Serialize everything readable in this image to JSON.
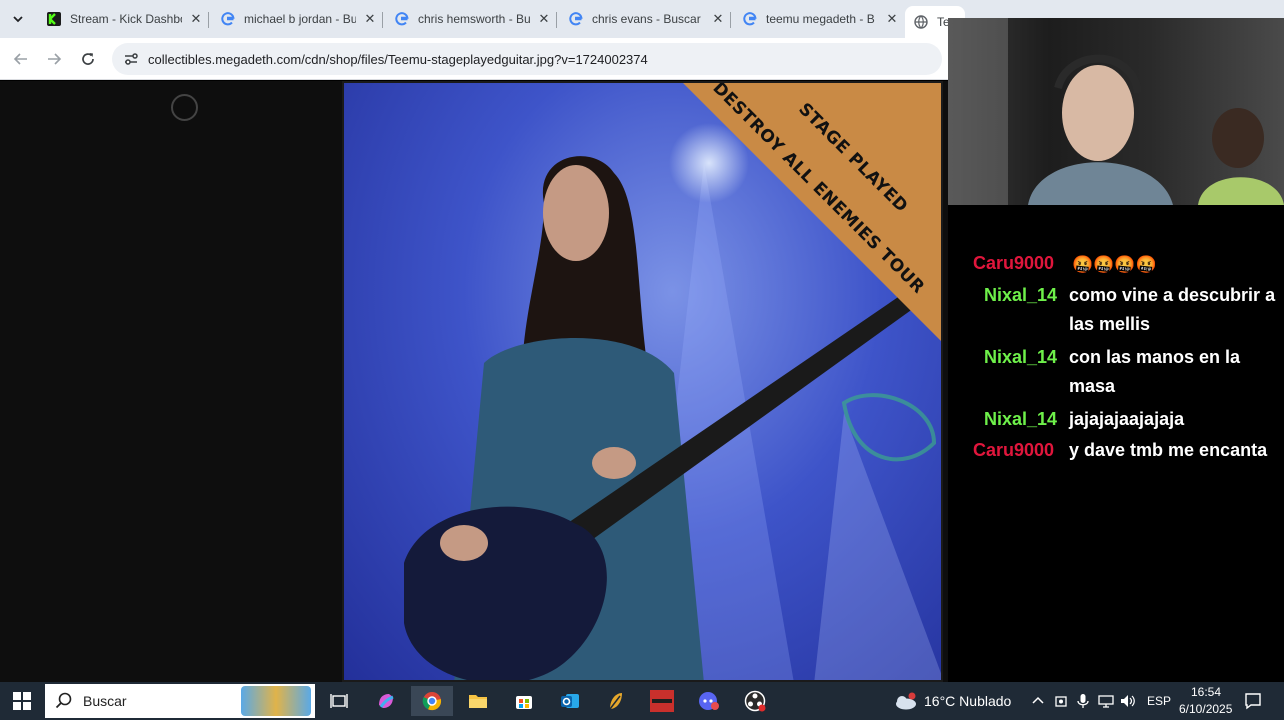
{
  "browser": {
    "tabs": [
      {
        "title": "Stream - Kick Dashbo",
        "icon": "kick-icon"
      },
      {
        "title": "michael b jordan - Bu",
        "icon": "google-icon"
      },
      {
        "title": "chris hemsworth - Bu",
        "icon": "google-icon"
      },
      {
        "title": "chris evans - Buscar c",
        "icon": "google-icon"
      },
      {
        "title": "teemu megadeth - B",
        "icon": "google-icon"
      },
      {
        "title": "Te",
        "icon": "globe-icon",
        "active": true
      }
    ],
    "url": "collectibles.megadeth.com/cdn/shop/files/Teemu-stageplayedguitar.jpg?v=1724002374"
  },
  "image": {
    "banner_line1": "STAGE PLAYED",
    "banner_line2": "DESTROY ALL ENEMIES TOUR",
    "banner_color": "#c98a45"
  },
  "chat": {
    "messages": [
      {
        "user": "Caru9000",
        "user_color": "#e0163c",
        "text": "🤬🤬🤬🤬"
      },
      {
        "user": "Nixal_14",
        "user_color": "#6ef04a",
        "text": "como vine a descubrir a las mellis"
      },
      {
        "user": "Nixal_14",
        "user_color": "#6ef04a",
        "text": "con las manos en la masa"
      },
      {
        "user": "Nixal_14",
        "user_color": "#6ef04a",
        "text": "jajajajaajajaja"
      },
      {
        "user": "Caru9000",
        "user_color": "#e0163c",
        "text": "y dave tmb me encanta"
      }
    ]
  },
  "taskbar": {
    "search_label": "Buscar",
    "weather": "16°C  Nublado",
    "language": "ESP",
    "time": "16:54",
    "date": "6/10/2025"
  }
}
